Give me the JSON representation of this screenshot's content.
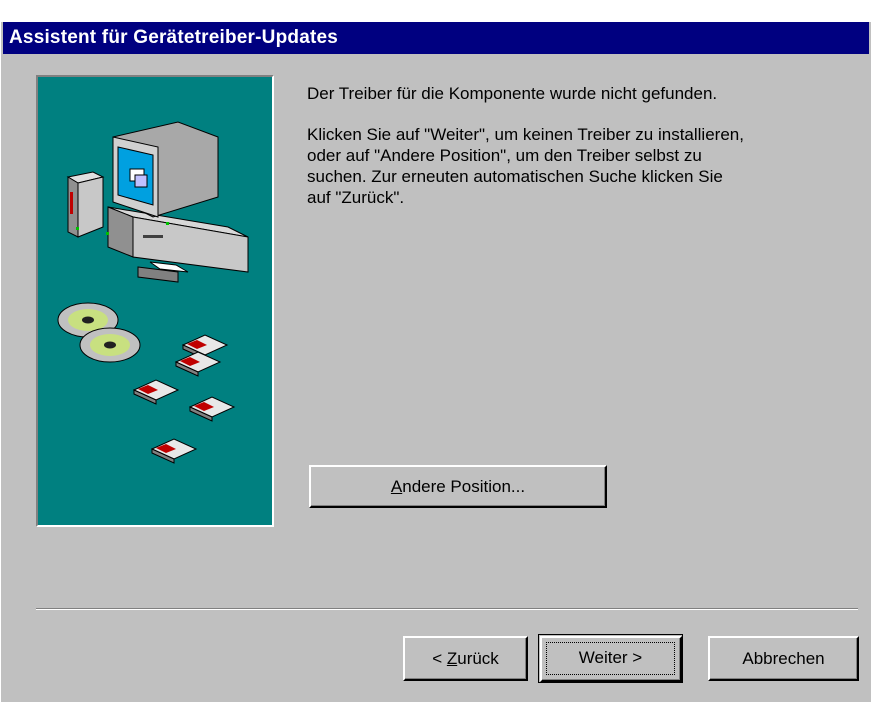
{
  "window": {
    "title": "Assistent für Gerätetreiber-Updates"
  },
  "content": {
    "message_1": "Der Treiber für die Komponente wurde nicht gefunden.",
    "message_2": "Klicken Sie auf \"Weiter\", um keinen Treiber zu installieren,\noder auf \"Andere Position\", um den Treiber selbst zu\nsuchen. Zur erneuten automatischen Suche klicken Sie\nauf \"Zurück\"."
  },
  "buttons": {
    "other_position": {
      "mnemonic": "A",
      "rest": "ndere Position..."
    },
    "back": {
      "prefix": "< ",
      "mnemonic": "Z",
      "rest": "urück"
    },
    "next": "Weiter >",
    "cancel": "Abbrechen"
  },
  "colors": {
    "titlebar": "#000080",
    "illustration_bg": "#008080",
    "dialog_bg": "#c0c0c0"
  },
  "icons": [
    "computer-icon",
    "cd-icon",
    "floppy-disk-icon"
  ]
}
